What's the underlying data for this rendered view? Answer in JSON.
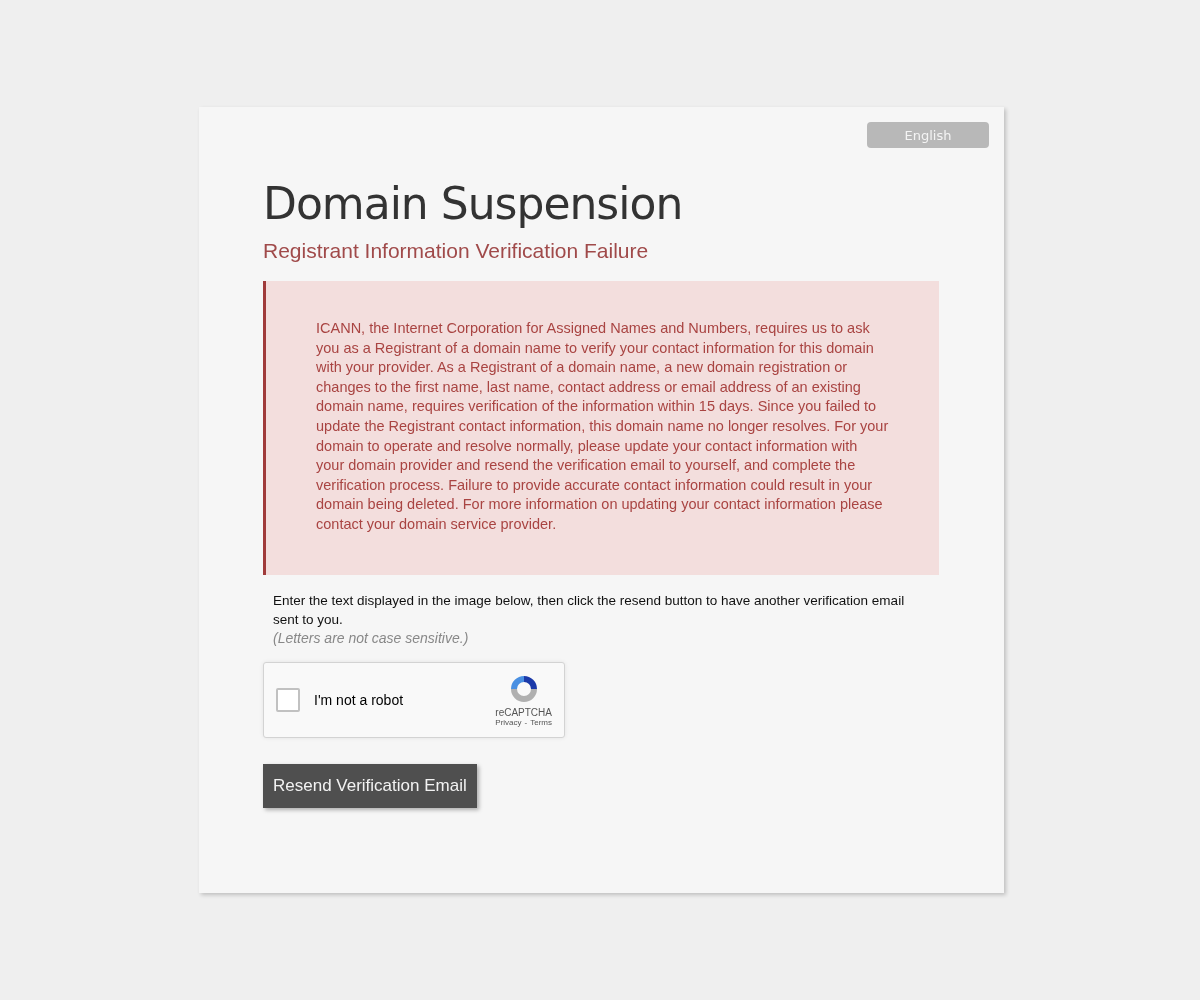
{
  "language_button": {
    "label": "English"
  },
  "title": "Domain Suspension",
  "subtitle": "Registrant Information Verification Failure",
  "alert": {
    "text": "ICANN, the Internet Corporation for Assigned Names and Numbers, requires us to ask you as a Registrant of a domain name to verify your contact information for this domain with your provider. As a Registrant of a domain name, a new domain registration or changes to the first name, last name, contact address or email address of an existing domain name, requires verification of the information within 15 days. Since you failed to update the Registrant contact information, this domain name no longer resolves. For your domain to operate and resolve normally, please update your contact information with your domain provider and resend the verification email to yourself, and complete the verification process. Failure to provide accurate contact information could result in your domain being deleted. For more information on updating your contact information please contact your domain service provider."
  },
  "instructions": "Enter the text displayed in the image below, then click the resend button to have another verification email sent to you.",
  "note": "(Letters are not case sensitive.)",
  "captcha": {
    "label": "I'm not a robot",
    "checked": false,
    "brand": "reCAPTCHA",
    "privacy": "Privacy",
    "separator": "-",
    "terms": "Terms"
  },
  "submit_button": {
    "label": "Resend Verification Email"
  }
}
